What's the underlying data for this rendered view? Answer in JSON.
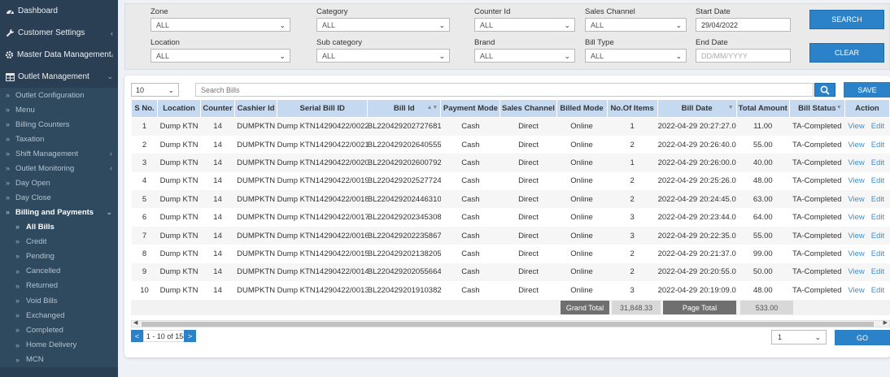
{
  "sidebar": {
    "top_items": [
      {
        "label": "Dashboard",
        "icon": "tachometer-icon"
      },
      {
        "label": "Customer Settings",
        "icon": "wrench-icon",
        "arrow": "‹"
      },
      {
        "label": "Master Data Management",
        "icon": "gear-icon",
        "arrow": "‹"
      },
      {
        "label": "Outlet Management",
        "icon": "table-icon",
        "arrow": "⌄"
      }
    ],
    "outlet_sub": [
      {
        "label": "Outlet Configuration"
      },
      {
        "label": "Menu"
      },
      {
        "label": "Billing Counters"
      },
      {
        "label": "Taxation"
      },
      {
        "label": "Shift Management",
        "arrow": "‹"
      },
      {
        "label": "Outlet Monitoring",
        "arrow": "‹"
      },
      {
        "label": "Day Open"
      },
      {
        "label": "Day Close"
      },
      {
        "label": "Billing and Payments",
        "arrow": "⌄"
      }
    ],
    "billing_sub": [
      "All Bills",
      "Credit",
      "Pending",
      "Cancelled",
      "Returned",
      "Void Bills",
      "Exchanged",
      "Completed",
      "Home Delivery",
      "MCN"
    ]
  },
  "filters": {
    "zone": {
      "label": "Zone",
      "value": "ALL"
    },
    "category": {
      "label": "Category",
      "value": "ALL"
    },
    "counter_id": {
      "label": "Counter Id",
      "value": "ALL"
    },
    "sales_channel": {
      "label": "Sales Channel",
      "value": "ALL"
    },
    "start_date": {
      "label": "Start Date",
      "value": "29/04/2022"
    },
    "location": {
      "label": "Location",
      "value": "ALL"
    },
    "sub_category": {
      "label": "Sub category",
      "value": "ALL"
    },
    "brand": {
      "label": "Brand",
      "value": "ALL"
    },
    "bill_type": {
      "label": "Bill Type",
      "value": "ALL"
    },
    "end_date": {
      "label": "End Date",
      "placeholder": "DD/MM/YYYY"
    },
    "search_label": "SEARCH",
    "clear_label": "CLEAR"
  },
  "toolbar": {
    "page_size": "10",
    "search_placeholder": "Search Bills",
    "save_label": "SAVE"
  },
  "table": {
    "columns": [
      "S No.",
      "Location",
      "Counter",
      "Cashier Id",
      "Serial Bill ID",
      "Bill Id",
      "Payment Mode",
      "Sales Channel",
      "Billed Mode",
      "No.Of Items",
      "Bill Date",
      "Total Amount",
      "Bill Status",
      "Action"
    ],
    "rows": [
      [
        "1",
        "Dump KTN",
        "14",
        "DUMPKTN",
        "Dump KTN14290422/0022",
        "BL220429202727681",
        "Cash",
        "Direct",
        "Online",
        "1",
        "2022-04-29 20:27:27.0",
        "11.00",
        "TA-Completed"
      ],
      [
        "2",
        "Dump KTN",
        "14",
        "DUMPKTN",
        "Dump KTN14290422/0021",
        "BL220429202640555",
        "Cash",
        "Direct",
        "Online",
        "2",
        "2022-04-29 20:26:40.0",
        "55.00",
        "TA-Completed"
      ],
      [
        "3",
        "Dump KTN",
        "14",
        "DUMPKTN",
        "Dump KTN14290422/0020",
        "BL220429202600792",
        "Cash",
        "Direct",
        "Online",
        "1",
        "2022-04-29 20:26:00.0",
        "40.00",
        "TA-Completed"
      ],
      [
        "4",
        "Dump KTN",
        "14",
        "DUMPKTN",
        "Dump KTN14290422/0019",
        "BL220429202527724",
        "Cash",
        "Direct",
        "Online",
        "2",
        "2022-04-29 20:25:26.0",
        "48.00",
        "TA-Completed"
      ],
      [
        "5",
        "Dump KTN",
        "14",
        "DUMPKTN",
        "Dump KTN14290422/0018",
        "BL220429202446310",
        "Cash",
        "Direct",
        "Online",
        "2",
        "2022-04-29 20:24:45.0",
        "63.00",
        "TA-Completed"
      ],
      [
        "6",
        "Dump KTN",
        "14",
        "DUMPKTN",
        "Dump KTN14290422/0017",
        "BL220429202345308",
        "Cash",
        "Direct",
        "Online",
        "3",
        "2022-04-29 20:23:44.0",
        "64.00",
        "TA-Completed"
      ],
      [
        "7",
        "Dump KTN",
        "14",
        "DUMPKTN",
        "Dump KTN14290422/0016",
        "BL220429202235867",
        "Cash",
        "Direct",
        "Online",
        "3",
        "2022-04-29 20:22:35.0",
        "55.00",
        "TA-Completed"
      ],
      [
        "8",
        "Dump KTN",
        "14",
        "DUMPKTN",
        "Dump KTN14290422/0015",
        "BL220429202138205",
        "Cash",
        "Direct",
        "Online",
        "2",
        "2022-04-29 20:21:37.0",
        "99.00",
        "TA-Completed"
      ],
      [
        "9",
        "Dump KTN",
        "14",
        "DUMPKTN",
        "Dump KTN14290422/0014",
        "BL220429202055664",
        "Cash",
        "Direct",
        "Online",
        "2",
        "2022-04-29 20:20:55.0",
        "50.00",
        "TA-Completed"
      ],
      [
        "10",
        "Dump KTN",
        "14",
        "DUMPKTN",
        "Dump KTN14290422/0013",
        "BL220429201910382",
        "Cash",
        "Direct",
        "Online",
        "3",
        "2022-04-29 20:19:09.0",
        "48.00",
        "TA-Completed"
      ]
    ],
    "view_label": "View",
    "edit_label": "Edit"
  },
  "totals": {
    "grand_total_label": "Grand Total",
    "grand_total_value": "31,848.33",
    "page_total_label": "Page Total",
    "page_total_value": "533.00"
  },
  "pagination": {
    "prev": "<",
    "next": ">",
    "info": "1 - 10 of 158",
    "page_select": "1",
    "go_label": "GO"
  },
  "colors": {
    "sidebar_bg": "#2a3f54",
    "accent": "#2c82c9",
    "header_bg": "#c5daf1",
    "link": "#3a8fd5"
  }
}
